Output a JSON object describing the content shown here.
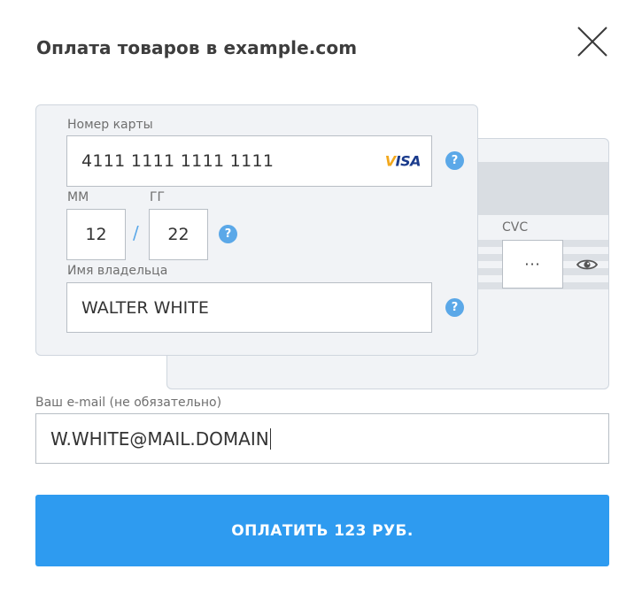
{
  "header": {
    "title": "Оплата товаров в example.com",
    "close_icon": "close-icon"
  },
  "card": {
    "number_label": "Номер карты",
    "number_value": "4111 1111 1111 1111",
    "brand": "VISA",
    "month_label": "ММ",
    "month_value": "12",
    "year_label": "ГГ",
    "year_value": "22",
    "separator": "/",
    "holder_label": "Имя владельца",
    "holder_value": "WALTER WHITE",
    "help_glyph": "?",
    "cvc_label": "CVC",
    "cvc_value": "···"
  },
  "email": {
    "label": "Ваш e-mail (не обязательно)",
    "value": "W.WHITE@MAIL.DOMAIN"
  },
  "pay_button": {
    "label": "ОПЛАТИТЬ 123 РУБ."
  },
  "colors": {
    "accent": "#2e9bf0",
    "help": "#5ba8e8",
    "card_bg": "#f1f3f6"
  }
}
